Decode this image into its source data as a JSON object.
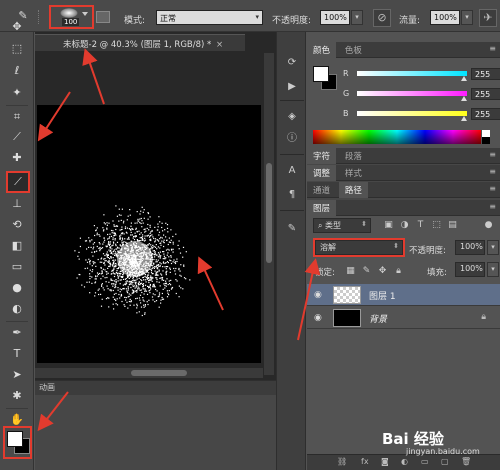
{
  "options_bar": {
    "brush_size": "100",
    "mode_label": "模式:",
    "mode_value": "正常",
    "opacity_label": "不透明度:",
    "opacity_value": "100%",
    "flow_label": "流量:",
    "flow_value": "100%"
  },
  "document": {
    "tab_title": "未标题-2 @ 40.3% (图层 1, RGB/8) *",
    "close_glyph": "×",
    "lower_panel_label": "动画"
  },
  "color_panel": {
    "tabs": [
      "颜色",
      "色板"
    ],
    "channels": [
      {
        "name": "R",
        "value": "255",
        "color": "#00e5ff"
      },
      {
        "name": "G",
        "value": "255",
        "color": "#ff1aff"
      },
      {
        "name": "B",
        "value": "255",
        "color": "#ffff1a"
      }
    ]
  },
  "panel_groups": {
    "group1_tabs": [
      "字符",
      "段落"
    ],
    "group2_tabs": [
      "调整",
      "样式"
    ],
    "group3_tabs": [
      "通道",
      "路径"
    ]
  },
  "layers_panel": {
    "title": "图层",
    "filter_label": "类型",
    "blend_mode": "溶解",
    "opacity_label": "不透明度:",
    "opacity_value": "100%",
    "lock_label": "锁定:",
    "fill_label": "填充:",
    "fill_value": "100%",
    "layers": [
      {
        "name": "图层 1",
        "selected": true,
        "thumb": "transparent"
      },
      {
        "name": "背景",
        "selected": false,
        "thumb": "black",
        "locked": true
      }
    ]
  },
  "watermark": {
    "brand": "Bai 经验",
    "url": "jingyan.baidu.com"
  },
  "colors": {
    "accent_red": "#e23b2e",
    "selected_layer": "#5f6f8a",
    "foreground": "#ffffff",
    "background": "#000000"
  }
}
